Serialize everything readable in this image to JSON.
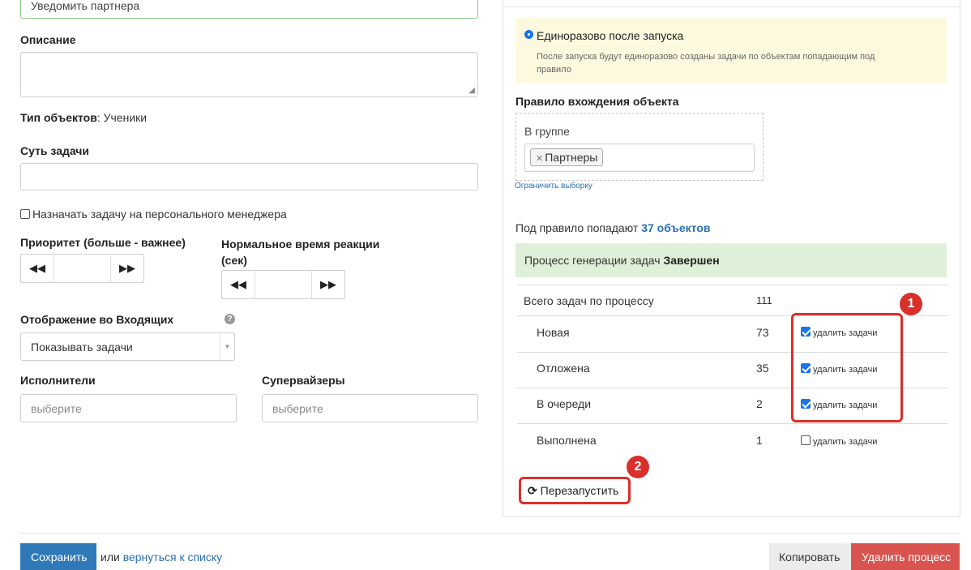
{
  "left": {
    "name_value": "Уведомить партнера",
    "description_label": "Описание",
    "object_type_label": "Тип объектов",
    "object_type_value": ": Ученики",
    "task_essence_label": "Суть задачи",
    "assign_personal_label": "Назначать задачу на персонального менеджера",
    "priority_label": "Приоритет (больше - важнее)",
    "reaction_label_1": "Нормальное время реакции",
    "reaction_label_2": "(сек)",
    "inbox_label": "Отображение во Входящих",
    "inbox_value": "Показывать задачи",
    "executors_label": "Исполнители",
    "executors_placeholder": "выберите",
    "supervisors_label": "Супервайзеры",
    "supervisors_placeholder": "выберите"
  },
  "right": {
    "once_label": "Единоразово после запуска",
    "once_desc_1": "После запуска будут единоразово созданы задачи по объектам попадающим под",
    "once_desc_2": "правило",
    "rule_label": "Правило вхождения объекта",
    "group_label": "В группе",
    "tag": "Партнеры",
    "limit_link": "Ограничить выборку",
    "match_text": "Под правило попадают ",
    "match_count": "37 объектов",
    "process_text": "Процесс генерации задач ",
    "process_status": "Завершен",
    "total_label": "Всего задач по процессу",
    "total_value": "111",
    "rows": [
      {
        "label": "Новая",
        "count": "73",
        "action": "удалить задачи",
        "checked": true
      },
      {
        "label": "Отложена",
        "count": "35",
        "action": "удалить задачи",
        "checked": true
      },
      {
        "label": "В очереди",
        "count": "2",
        "action": "удалить задачи",
        "checked": true
      },
      {
        "label": "Выполнена",
        "count": "1",
        "action": "удалить задачи",
        "checked": false
      }
    ],
    "restart_label": "Перезапустить",
    "badge1": "1",
    "badge2": "2"
  },
  "footer": {
    "save_label": "Сохранить",
    "or_text": "или",
    "back_link": "вернуться к списку",
    "copy_label": "Копировать",
    "delete_label": "Удалить процесс"
  },
  "colors": {
    "primary": "#2f79b9",
    "danger": "#d9534f",
    "annotation_red": "#d9302c",
    "notice_yellow": "#fcf9de",
    "success_green": "#dff0d8"
  }
}
